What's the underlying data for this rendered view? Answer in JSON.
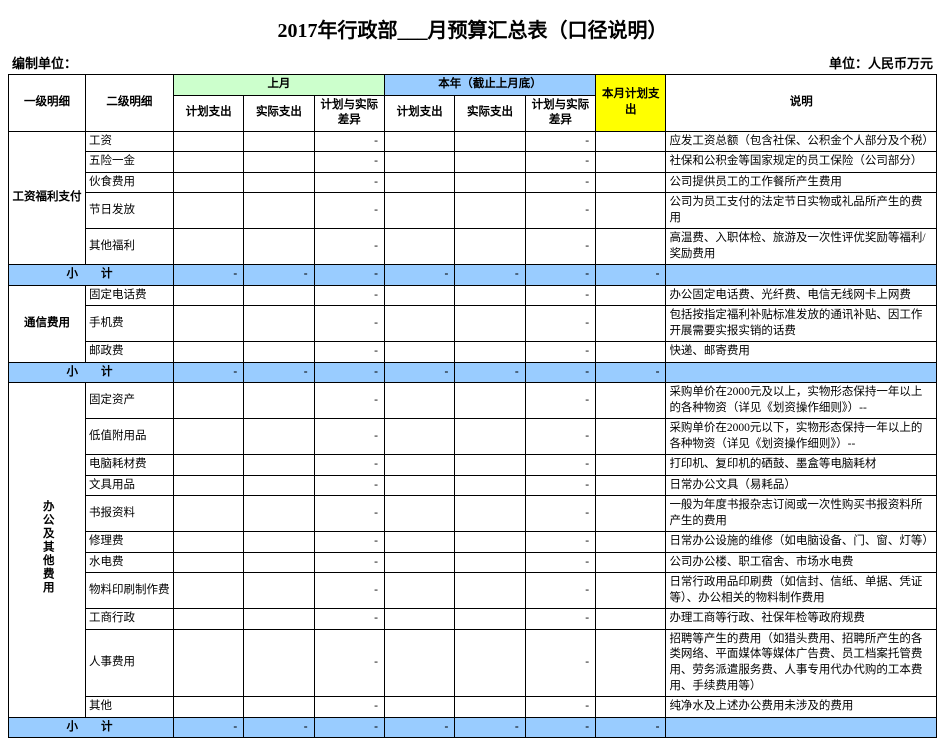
{
  "title": "2017年行政部___月预算汇总表（口径说明）",
  "meta": {
    "left": "编制单位：",
    "right": "单位：人民币万元"
  },
  "headers": {
    "cat": "一级明细",
    "sub": "二级明细",
    "group_prev": "上月",
    "group_ytd": "本年（截止上月底）",
    "month_plan": "本月计划支出",
    "plan": "计划支出",
    "actual": "实际支出",
    "diff": "计划与实际差异",
    "desc": "说明",
    "subtotal": "小计"
  },
  "dash": "-",
  "sections": [
    {
      "cat": "工资福利支付",
      "rotate": false,
      "rows": [
        {
          "sub": "工资",
          "desc": "应发工资总额（包含社保、公积金个人部分及个税）"
        },
        {
          "sub": "五险一金",
          "desc": "社保和公积金等国家规定的员工保险（公司部分）"
        },
        {
          "sub": "伙食费用",
          "desc": "公司提供员工的工作餐所产生费用"
        },
        {
          "sub": "节日发放",
          "desc": "公司为员工支付的法定节日实物或礼品所产生的费用"
        },
        {
          "sub": "其他福利",
          "desc": "高温费、入职体检、旅游及一次性评优奖励等福利/奖励费用"
        }
      ]
    },
    {
      "cat": "通信费用",
      "rotate": false,
      "rows": [
        {
          "sub": "固定电话费",
          "desc": "办公固定电话费、光纤费、电信无线网卡上网费"
        },
        {
          "sub": "手机费",
          "desc": "包括按指定福利补贴标准发放的通讯补贴、因工作开展需要实报实销的话费"
        },
        {
          "sub": "邮政费",
          "desc": "快递、邮寄费用"
        }
      ]
    },
    {
      "cat": "办公及其他费用",
      "rotate": true,
      "rows": [
        {
          "sub": "固定资产",
          "desc": "采购单价在2000元及以上，实物形态保持一年以上的各种物资（详见《划资操作细则》）--"
        },
        {
          "sub": "低值附用品",
          "desc": "采购单价在2000元以下，实物形态保持一年以上的各种物资（详见《划资操作细则》）--"
        },
        {
          "sub": "电脑耗材费",
          "desc": "打印机、复印机的硒鼓、墨盒等电脑耗材"
        },
        {
          "sub": "文具用品",
          "desc": "日常办公文具（易耗品）"
        },
        {
          "sub": "书报资料",
          "desc": "一般为年度书报杂志订阅或一次性购买书报资料所产生的费用"
        },
        {
          "sub": "修理费",
          "desc": "日常办公设施的维修（如电脑设备、门、窗、灯等）"
        },
        {
          "sub": "水电费",
          "desc": "公司办公楼、职工宿舍、市场水电费"
        },
        {
          "sub": "物料印刷制作费",
          "desc": "  日常行政用品印刷费（如信封、信纸、单据、凭证等）、办公相关的物料制作费用"
        },
        {
          "sub": "工商行政",
          "desc": "  办理工商等行政、社保年检等政府规费"
        },
        {
          "sub": "人事费用",
          "desc": "招聘等产生的费用（如猎头费用、招聘所产生的各类网络、平面媒体等媒体广告费、员工档案托管费用、劳务派遣服务费、人事专用代办代购的工本费用、手续费用等）"
        },
        {
          "sub": "其他",
          "desc": "纯净水及上述办公费用未涉及的费用"
        }
      ]
    }
  ]
}
